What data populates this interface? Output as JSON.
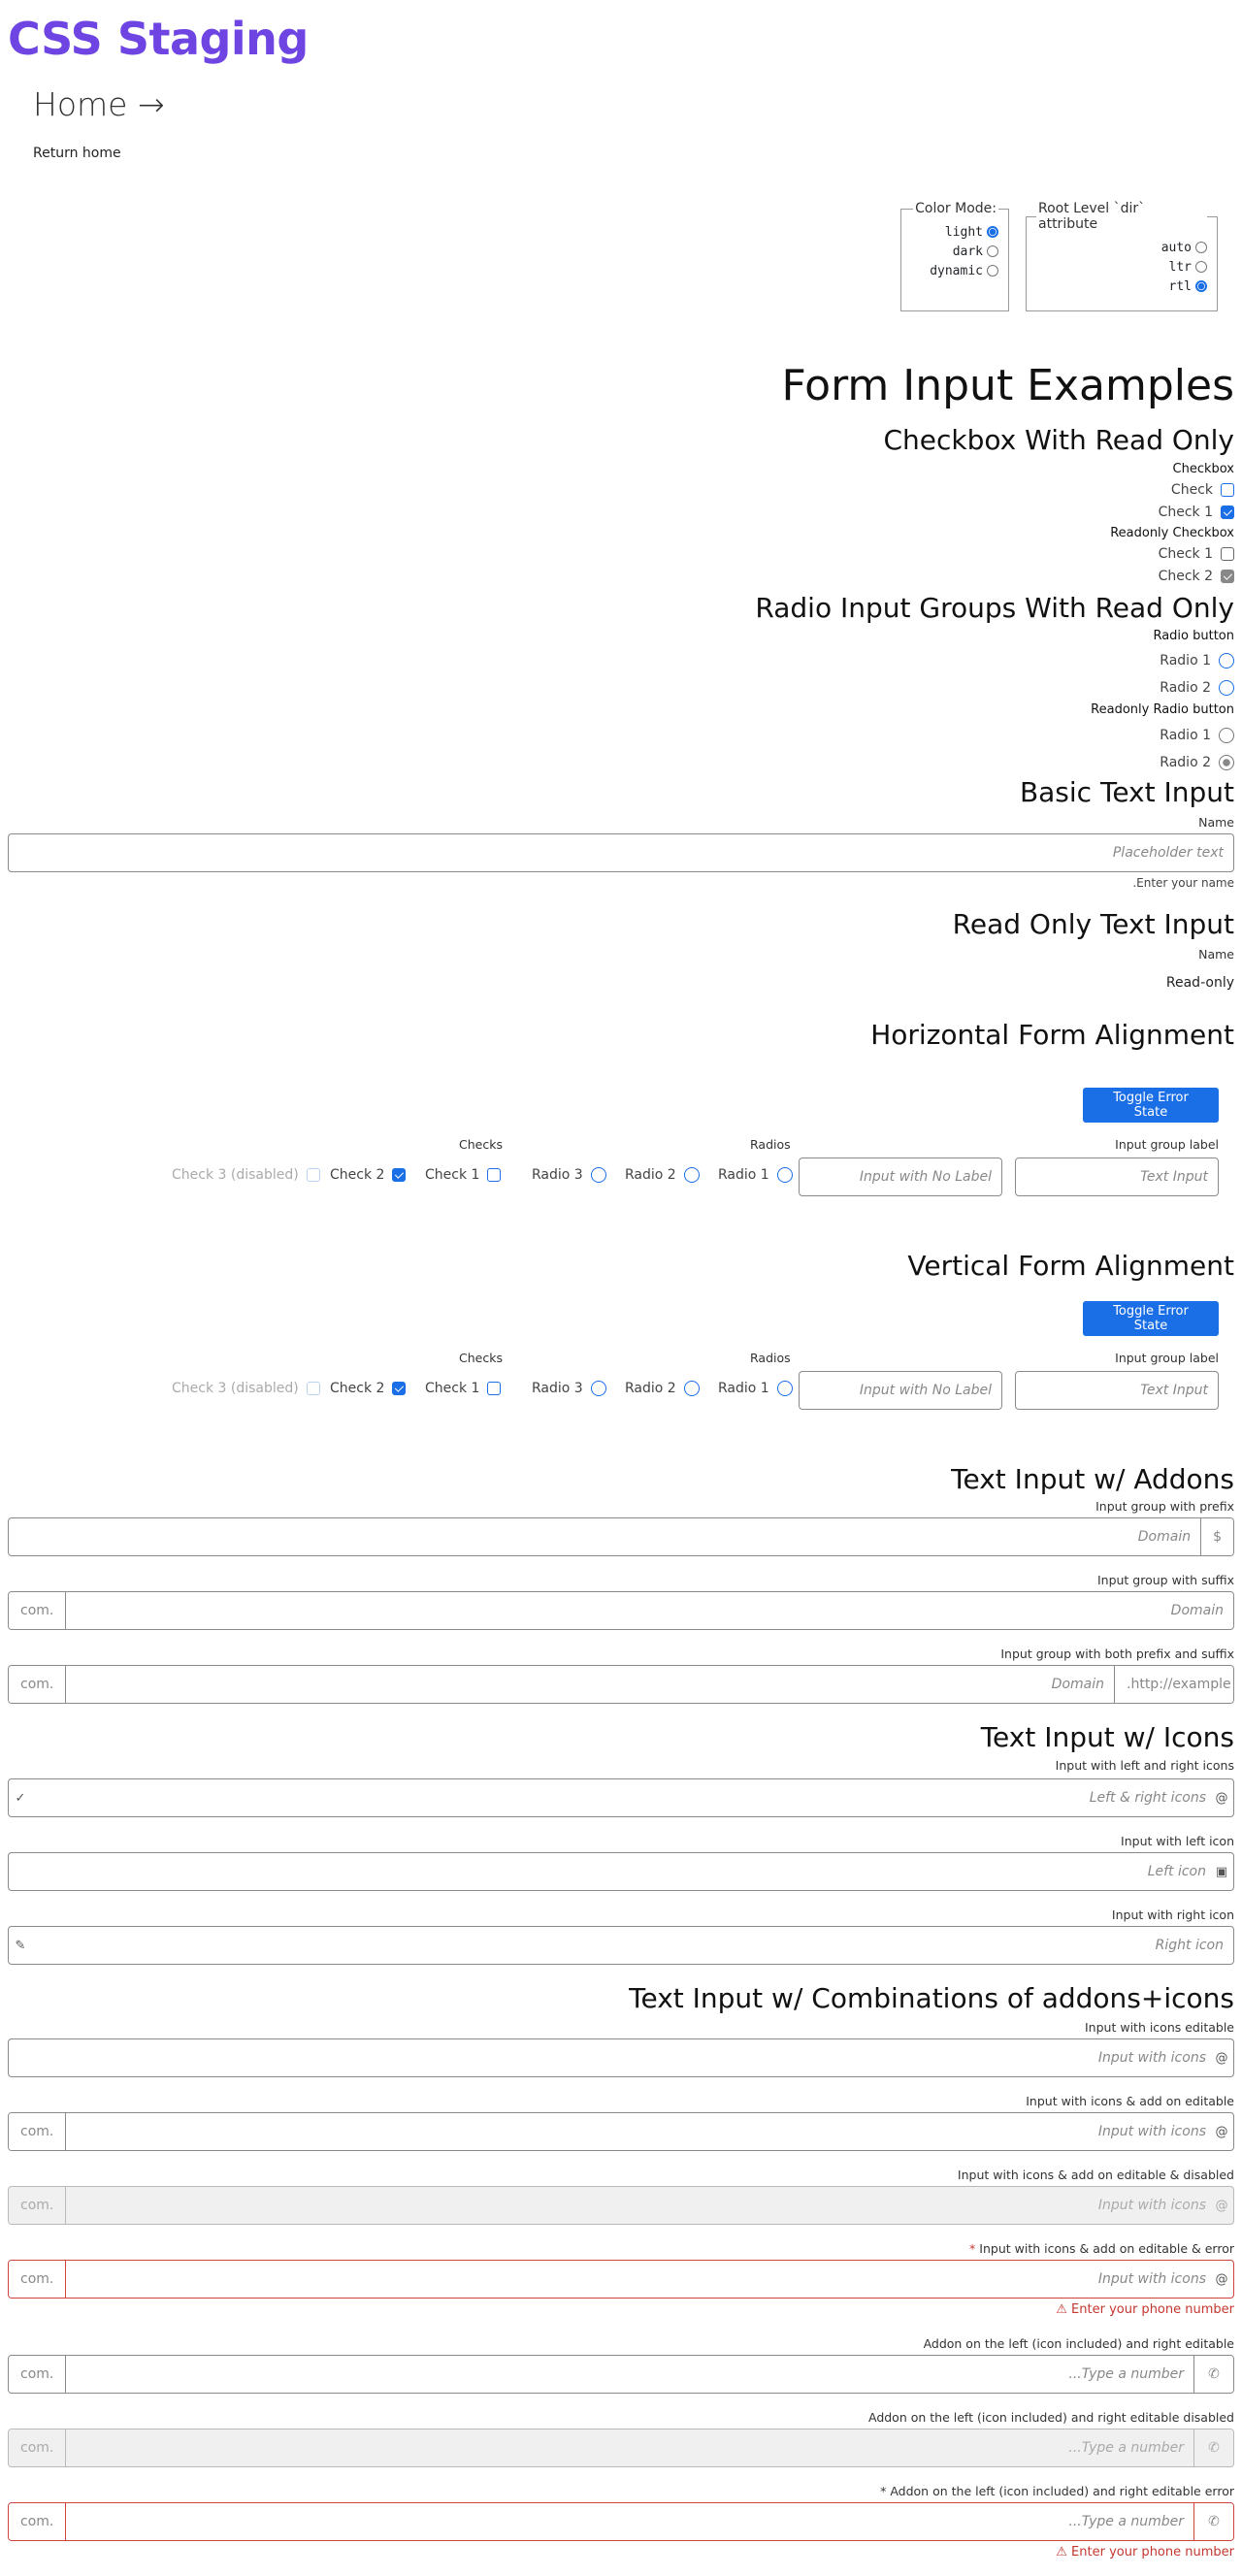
{
  "site": {
    "title": "CSS Staging",
    "home_link": "Home →",
    "return_home": "Return home"
  },
  "settings": {
    "color_mode": {
      "legend": "Color Mode",
      "options": [
        "light",
        "dark",
        "dynamic"
      ],
      "selected": "light"
    },
    "dir": {
      "legend": "Root Level `dir` attribute",
      "options": [
        "auto",
        "ltr",
        "rtl"
      ],
      "selected": "rtl"
    }
  },
  "page": {
    "title": "Form Input Examples"
  },
  "checkbox_section": {
    "title": "Checkbox With Read Only",
    "group1_label": "Checkbox",
    "group1": [
      {
        "label": "Check",
        "checked": false
      },
      {
        "label": "Check 1",
        "checked": true
      }
    ],
    "group2_label": "Readonly Checkbox",
    "group2": [
      {
        "label": "Check 1",
        "checked": false
      },
      {
        "label": "Check 2",
        "checked": true
      }
    ]
  },
  "radio_section": {
    "title": "Radio Input Groups With Read Only",
    "group1_label": "Radio button",
    "group1": [
      "Radio 1",
      "Radio 2"
    ],
    "group2_label": "Readonly Radio button",
    "group2": [
      "Radio 1",
      "Radio 2"
    ],
    "group2_selected": "Radio 2"
  },
  "basic_text": {
    "title": "Basic Text Input",
    "label": "Name",
    "placeholder": "Placeholder text",
    "help": ".Enter your name"
  },
  "readonly_text": {
    "title": "Read Only Text Input",
    "label": "Name",
    "value": "Read-only"
  },
  "horizontal": {
    "title": "Horizontal Form Alignment",
    "toggle_label": "Toggle Error State",
    "input_group_label": "Input group label",
    "text_input_placeholder": "Text Input",
    "no_label_placeholder": "Input with No Label",
    "radios_caption": "Radios",
    "radios": [
      "Radio 1",
      "Radio 2",
      "Radio 3"
    ],
    "checks_caption": "Checks",
    "checks": [
      {
        "label": "Check 1",
        "checked": false
      },
      {
        "label": "Check 2",
        "checked": true
      },
      {
        "label": "Check 3 (disabled)",
        "checked": false
      }
    ]
  },
  "vertical": {
    "title": "Vertical Form Alignment",
    "toggle_label": "Toggle Error State",
    "input_group_label": "Input group label",
    "text_input_placeholder": "Text Input",
    "no_label_placeholder": "Input with No Label",
    "radios_caption": "Radios",
    "radios": [
      "Radio 1",
      "Radio 2",
      "Radio 3"
    ],
    "checks_caption": "Checks",
    "checks": [
      {
        "label": "Check 1",
        "checked": false
      },
      {
        "label": "Check 2",
        "checked": true
      },
      {
        "label": "Check 3 (disabled)",
        "checked": false
      }
    ]
  },
  "addons": {
    "title": "Text Input w/ Addons",
    "prefix": {
      "label": "Input group with prefix",
      "placeholder": "Domain",
      "addon": "$"
    },
    "suffix": {
      "label": "Input group with suffix",
      "placeholder": "Domain",
      "addon": "com."
    },
    "both": {
      "label": "Input group with both prefix and suffix",
      "placeholder": "Domain",
      "prefix": ".http://example",
      "suffix": "com."
    }
  },
  "icons": {
    "title": "Text Input w/ Icons",
    "both": {
      "label": "Input with left and right icons",
      "placeholder": "Left & right icons",
      "right_icon": "at-icon",
      "left_icon": "check-icon"
    },
    "left": {
      "label": "Input with left icon",
      "placeholder": "Left icon",
      "icon": "user-card-icon"
    },
    "right": {
      "label": "Input with right icon",
      "placeholder": "Right icon",
      "icon": "pencil-icon"
    }
  },
  "combos": {
    "title": "Text Input w/ Combinations of addons+icons",
    "editable": {
      "label": "Input with icons editable",
      "placeholder": "Input with icons"
    },
    "addon_editable": {
      "label": "Input with icons & add on editable",
      "placeholder": "Input with icons",
      "addon": "com."
    },
    "addon_disabled": {
      "label": "Input with icons & add on editable & disabled",
      "placeholder": "Input with icons",
      "addon": "com."
    },
    "addon_error": {
      "label": "Input with icons & add on editable & error",
      "placeholder": "Input with icons",
      "addon": "com.",
      "error": "Enter your phone number"
    },
    "phone_editable": {
      "label": "Addon on the left (icon included) and right editable",
      "placeholder": "...Type a number",
      "addon": "com."
    },
    "phone_disabled": {
      "label": "Addon on the left (icon included) and right editable disabled",
      "placeholder": "...Type a number",
      "addon": "com."
    },
    "phone_error": {
      "label": "Addon on the left (icon included) and right editable error",
      "placeholder": "...Type a number",
      "addon": "com.",
      "error": "Enter your phone number"
    }
  },
  "colors": {
    "brand": "#6e45e2",
    "accent": "#1a6ee6",
    "error": "#c4372f"
  }
}
